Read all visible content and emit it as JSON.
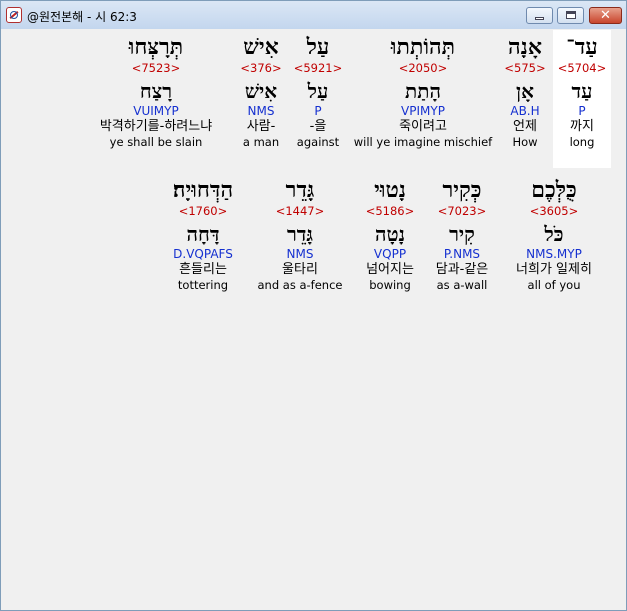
{
  "window": {
    "title": "@원전본해 - 시 62:3"
  },
  "lines": [
    {
      "words": [
        {
          "hebrew": "עַד־",
          "strong": "<5704>",
          "lemma": "עַד",
          "morph": "P",
          "korean": "까지",
          "english": "long"
        },
        {
          "hebrew": "אָנָה",
          "strong": "<575>",
          "lemma": "אָן",
          "morph": "AB.H",
          "korean": "언제",
          "english": "How"
        },
        {
          "hebrew": "תְּהוֹתְתוּ",
          "strong": "<2050>",
          "lemma": "הָתַת",
          "morph": "VPIMYP",
          "korean": "죽이려고",
          "english": "will ye imagine mischief"
        },
        {
          "hebrew": "עַל",
          "strong": "<5921>",
          "lemma": "עַל",
          "morph": "P",
          "korean": "-을",
          "english": "against"
        },
        {
          "hebrew": "אִישׁ",
          "strong": "<376>",
          "lemma": "אִישׁ",
          "morph": "NMS",
          "korean": "사람-",
          "english": "a man"
        },
        {
          "hebrew": "תְּרָצְּחוּ",
          "strong": "<7523>",
          "lemma": "רָצַח",
          "morph": "VUIMYP",
          "korean": "박격하기를-하려느냐",
          "english": "ye shall be slain"
        }
      ]
    },
    {
      "words": [
        {
          "hebrew": "כֻּלְּכֶם",
          "strong": "<3605>",
          "lemma": "כֹּל",
          "morph": "NMS.MYP",
          "korean": "너희가 일제히",
          "english": "all of you"
        },
        {
          "hebrew": "כְּקִיר",
          "strong": "<7023>",
          "lemma": "קִיר",
          "morph": "P.NMS",
          "korean": "담과-같은",
          "english": "as a-wall"
        },
        {
          "hebrew": "נָטוּי",
          "strong": "<5186>",
          "lemma": "נָטָה",
          "morph": "VQPP",
          "korean": "넘어지는",
          "english": "bowing"
        },
        {
          "hebrew": "גָּדֵר",
          "strong": "<1447>",
          "lemma": "גָּדֵר",
          "morph": "NMS",
          "korean": "울타리",
          "english": "and as a-fence"
        },
        {
          "hebrew": "הַדְּחוּיָה׃",
          "strong": "<1760>",
          "lemma": "דָּחָה",
          "morph": "D.VQPAFS",
          "korean": "흔들리는",
          "english": "tottering"
        }
      ]
    }
  ]
}
